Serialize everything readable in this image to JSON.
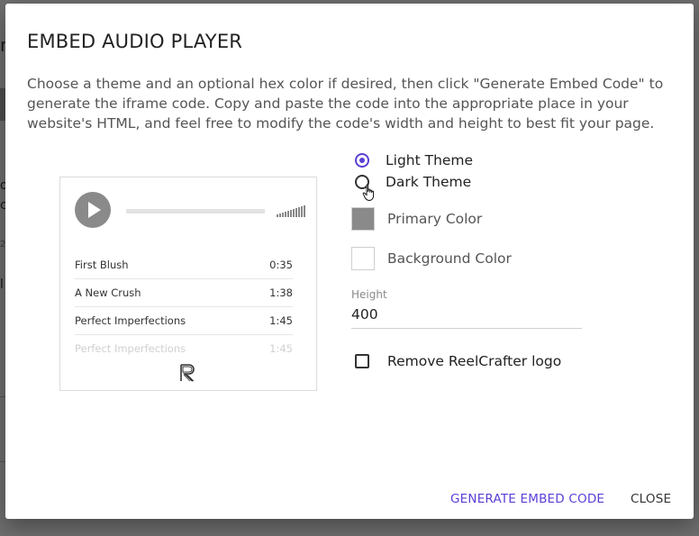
{
  "dialog": {
    "title": "EMBED AUDIO PLAYER",
    "description": "Choose a theme and an optional hex color if desired, then click \"Generate Embed Code\" to generate the iframe code. Copy and paste the code into the appropriate place in your website's HTML, and feel free to modify the code's width and height to best fit your page."
  },
  "background": {
    "glyphs": [
      "n",
      "o",
      "c",
      "2",
      "l"
    ]
  },
  "preview": {
    "tracks": [
      {
        "title": "First Blush",
        "duration": "0:35"
      },
      {
        "title": "A New Crush",
        "duration": "1:38"
      },
      {
        "title": "Perfect Imperfections",
        "duration": "1:45"
      },
      {
        "title": "Perfect Imperfections",
        "duration": "1:45"
      }
    ]
  },
  "options": {
    "light_theme_label": "Light Theme",
    "dark_theme_label": "Dark Theme",
    "selected_theme": "Light Theme",
    "primary_color_label": "Primary Color",
    "primary_color": "#8a8a8a",
    "background_color_label": "Background Color",
    "background_color": "#ffffff",
    "height_label": "Height",
    "height_value": "400",
    "remove_logo_label": "Remove ReelCrafter logo",
    "remove_logo_checked": false
  },
  "colors": {
    "accent": "#5b3fd6"
  },
  "actions": {
    "generate_label": "GENERATE EMBED CODE",
    "close_label": "CLOSE"
  }
}
